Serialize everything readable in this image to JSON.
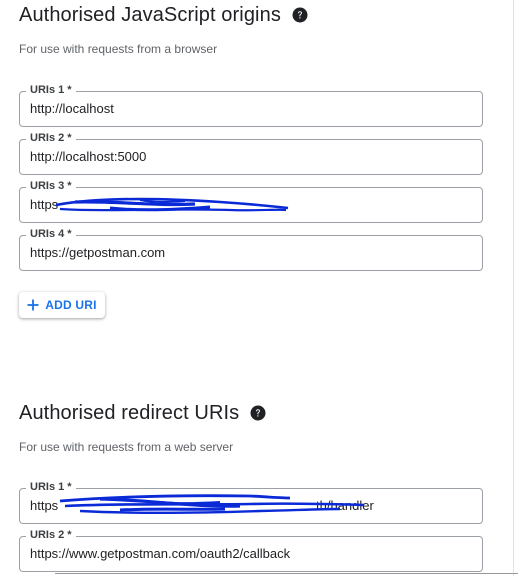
{
  "origins": {
    "title": "Authorised JavaScript origins",
    "subtitle": "For use with requests from a browser",
    "help_icon": "question-circle-icon",
    "uris": [
      {
        "label": "URIs 1 *",
        "value": "http://localhost"
      },
      {
        "label": "URIs 2 *",
        "value": "http://localhost:5000"
      },
      {
        "label": "URIs 3 *",
        "value": "https",
        "redacted": true
      },
      {
        "label": "URIs 4 *",
        "value": "https://getpostman.com"
      }
    ],
    "add_button": {
      "label": "ADD URI",
      "icon": "plus-icon"
    }
  },
  "redirect": {
    "title": "Authorised redirect URIs",
    "subtitle": "For use with requests from a web server",
    "help_icon": "question-circle-icon",
    "uris": [
      {
        "label": "URIs 1 *",
        "value": "https",
        "value_tail": "th/handler",
        "redacted": true
      },
      {
        "label": "URIs 2 *",
        "value": "https://www.getpostman.com/oauth2/callback"
      }
    ]
  },
  "colors": {
    "accent": "#1a73e8",
    "redaction": "#0a2ad8",
    "field_border": "#9aa0a6"
  }
}
